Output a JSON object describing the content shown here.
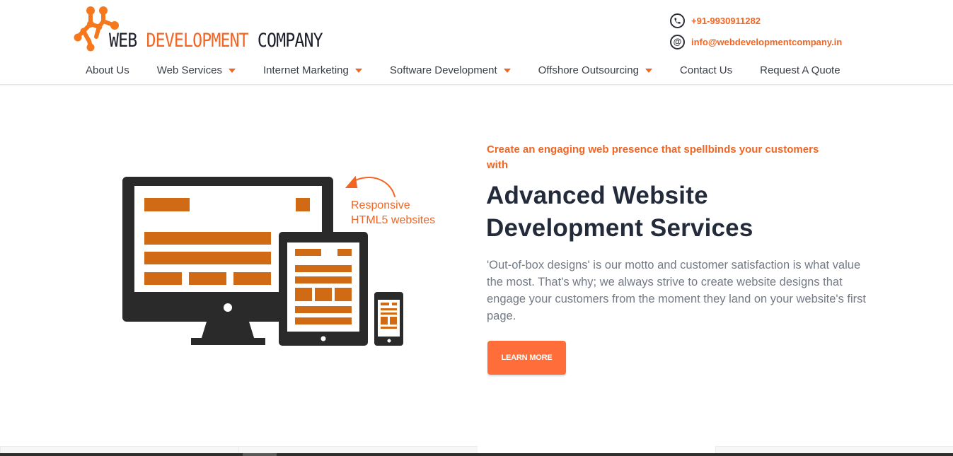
{
  "brand": {
    "name_part1": "WEB ",
    "name_part2": "DEVELOPMENT",
    "name_part3": " COMPANY",
    "accent_color": "#f26522",
    "dark_color": "#1d1f2b"
  },
  "contact": {
    "phone": {
      "icon": "phone-icon",
      "text": "+91-9930911282"
    },
    "email": {
      "icon": "at-icon",
      "text": "info@webdevelopmentcompany.in"
    }
  },
  "nav": {
    "items": [
      {
        "label": "About Us",
        "has_dropdown": false
      },
      {
        "label": "Web Services",
        "has_dropdown": true
      },
      {
        "label": "Internet Marketing",
        "has_dropdown": true
      },
      {
        "label": "Software Development",
        "has_dropdown": true
      },
      {
        "label": "Offshore Outsourcing",
        "has_dropdown": true
      },
      {
        "label": "Contact Us",
        "has_dropdown": false
      },
      {
        "label": "Request A Quote",
        "has_dropdown": false
      }
    ]
  },
  "hero": {
    "illustration_caption_line1": "Responsive",
    "illustration_caption_line2": "HTML5 websites",
    "tagline": "Create an engaging web presence that spellbinds your customers with",
    "headline_line1": "Advanced Website",
    "headline_line2": "Development Services",
    "description": "'Out-of-box designs' is our motto and customer satisfaction is what value the most. That's why; we always strive to create website designs that engage your customers from the moment they land on your website's first page.",
    "cta_label": "LEARN MORE",
    "cta_color": "#ff6d3a",
    "headline_color": "#232b3a"
  }
}
